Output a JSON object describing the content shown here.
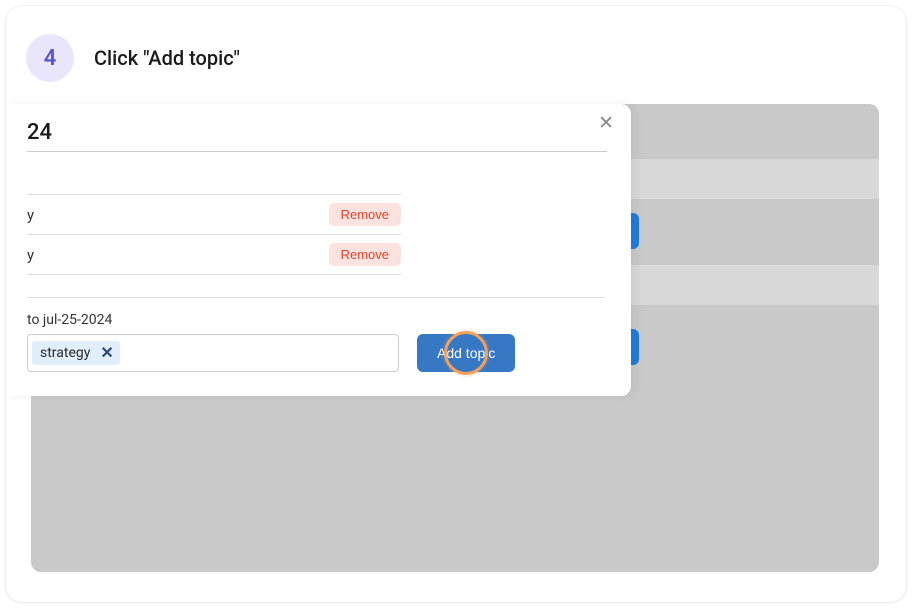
{
  "step": {
    "number": "4",
    "title": "Click \"Add topic\""
  },
  "modal": {
    "close_icon": "✕",
    "header_value": "24",
    "categories": [
      {
        "label": "y",
        "remove_label": "Remove"
      },
      {
        "label": "y",
        "remove_label": "Remove"
      }
    ],
    "date_label": "to jul-25-2024",
    "chip": {
      "text": "strategy",
      "close": "✕"
    },
    "add_topic_label": "Add topic"
  }
}
